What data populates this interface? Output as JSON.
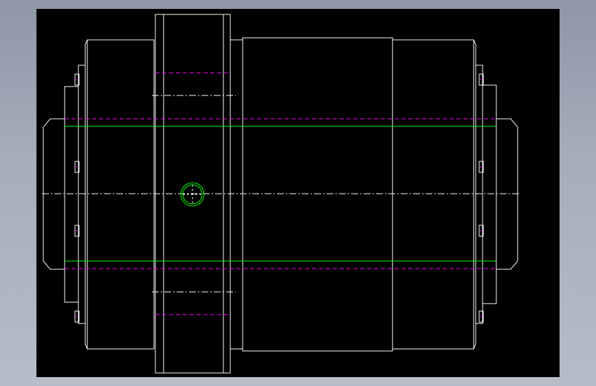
{
  "viewer": {
    "background": "#000000",
    "frame_background": "#a2abb8"
  },
  "layers": [
    {
      "name": "outline",
      "color": "#ffffff"
    },
    {
      "name": "centerline",
      "color": "#ffffff"
    },
    {
      "name": "hidden",
      "color": "#ff00ff"
    },
    {
      "name": "bore",
      "color": "#00ff00"
    }
  ]
}
